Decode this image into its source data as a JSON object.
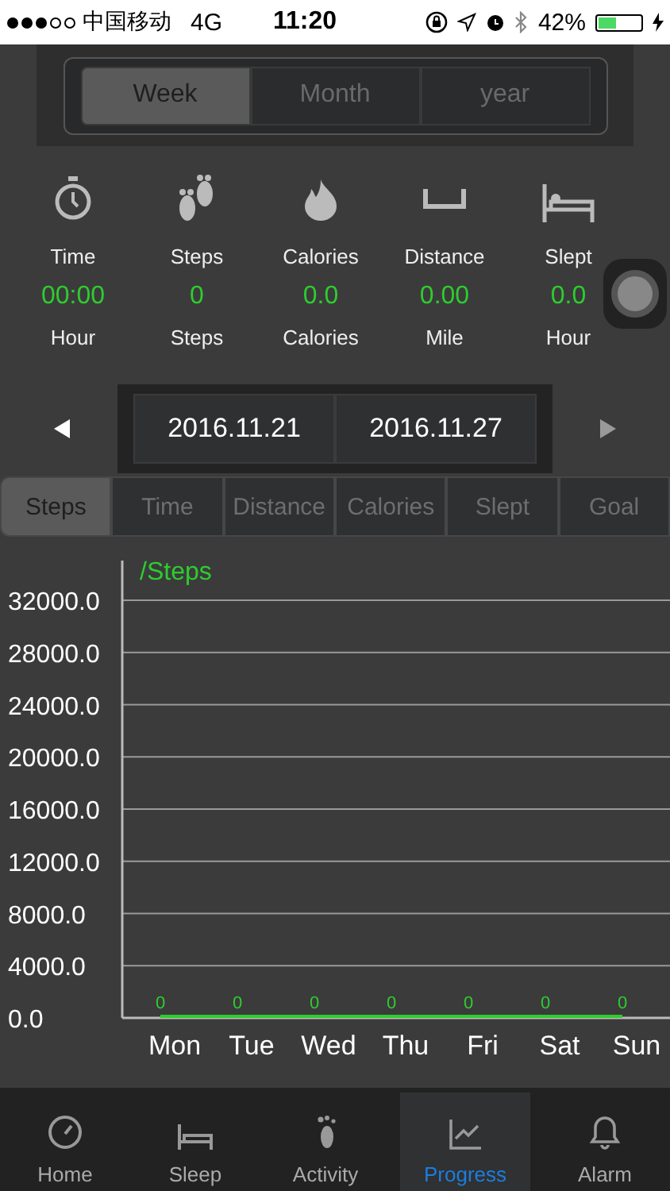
{
  "status_bar": {
    "carrier": "中国移动",
    "network": "4G",
    "time": "11:20",
    "battery_percent": "42%"
  },
  "period_tabs": [
    {
      "label": "Week",
      "selected": true
    },
    {
      "label": "Month",
      "selected": false
    },
    {
      "label": "year",
      "selected": false
    }
  ],
  "stats": [
    {
      "kind": "time",
      "label": "Time",
      "value": "00:00",
      "unit": "Hour"
    },
    {
      "kind": "steps",
      "label": "Steps",
      "value": "0",
      "unit": "Steps"
    },
    {
      "kind": "calories",
      "label": "Calories",
      "value": "0.0",
      "unit": "Calories"
    },
    {
      "kind": "distance",
      "label": "Distance",
      "value": "0.00",
      "unit": "Mile"
    },
    {
      "kind": "slept",
      "label": "Slept",
      "value": "0.0",
      "unit": "Hour"
    }
  ],
  "date_range": {
    "start": "2016.11.21",
    "end": "2016.11.27"
  },
  "metric_tabs": [
    {
      "label": "Steps",
      "selected": true
    },
    {
      "label": "Time",
      "selected": false
    },
    {
      "label": "Distance",
      "selected": false
    },
    {
      "label": "Calories",
      "selected": false
    },
    {
      "label": "Slept",
      "selected": false
    },
    {
      "label": "Goal",
      "selected": false
    }
  ],
  "chart_data": {
    "type": "line",
    "ylabel": "/Steps",
    "categories": [
      "Mon",
      "Tue",
      "Wed",
      "Thu",
      "Fri",
      "Sat",
      "Sun"
    ],
    "series": [
      {
        "color": "#2ecc2e",
        "values": [
          0,
          0,
          0,
          0,
          0,
          0,
          0
        ]
      }
    ],
    "grid": true,
    "ylim": [
      0,
      32000
    ],
    "yticks": [
      {
        "value": 0,
        "label": "0.0"
      },
      {
        "value": 4000,
        "label": "4000.0"
      },
      {
        "value": 8000,
        "label": "8000.0"
      },
      {
        "value": 12000,
        "label": "12000.0"
      },
      {
        "value": 16000,
        "label": "16000.0"
      },
      {
        "value": 20000,
        "label": "20000.0"
      },
      {
        "value": 24000,
        "label": "24000.0"
      },
      {
        "value": 28000,
        "label": "28000.0"
      },
      {
        "value": 32000,
        "label": "32000.0"
      }
    ],
    "data_labels": true
  },
  "tab_bar": [
    {
      "kind": "home",
      "label": "Home",
      "selected": false
    },
    {
      "kind": "sleep",
      "label": "Sleep",
      "selected": false
    },
    {
      "kind": "activity",
      "label": "Activity",
      "selected": false
    },
    {
      "kind": "progress",
      "label": "Progress",
      "selected": true
    },
    {
      "kind": "alarm",
      "label": "Alarm",
      "selected": false
    }
  ]
}
